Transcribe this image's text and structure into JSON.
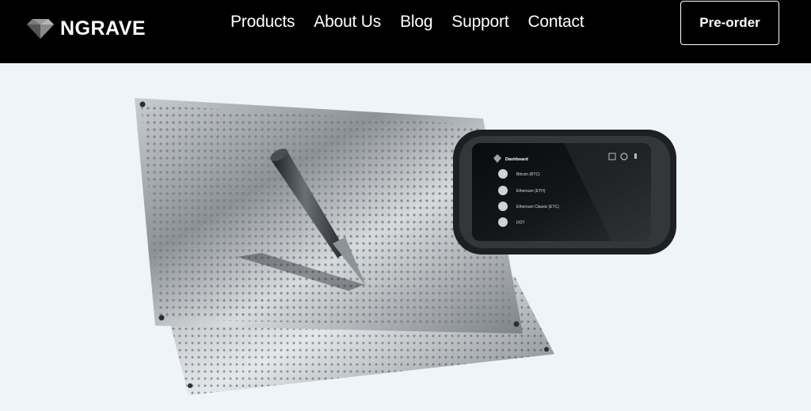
{
  "brand": {
    "name": "NGRAVE"
  },
  "nav": {
    "items": [
      {
        "label": "Products"
      },
      {
        "label": "About Us"
      },
      {
        "label": "Blog"
      },
      {
        "label": "Support"
      },
      {
        "label": "Contact"
      }
    ],
    "cta_label": "Pre-order"
  },
  "device_screen": {
    "title": "Dashboard",
    "assets": [
      {
        "name": "Bitcoin (BTC)",
        "icon": "bitcoin-icon"
      },
      {
        "name": "Ethereum (ETH)",
        "icon": "ethereum-icon"
      },
      {
        "name": "Ethereum Classic (ETC)",
        "icon": "ethereum-classic-icon"
      },
      {
        "name": "DOT",
        "icon": "polkadot-icon"
      }
    ]
  },
  "colors": {
    "header_bg": "#000000",
    "page_bg": "#eef4f7",
    "header_text": "#ffffff",
    "steel": "#a9adb1",
    "device_body": "#202224"
  }
}
